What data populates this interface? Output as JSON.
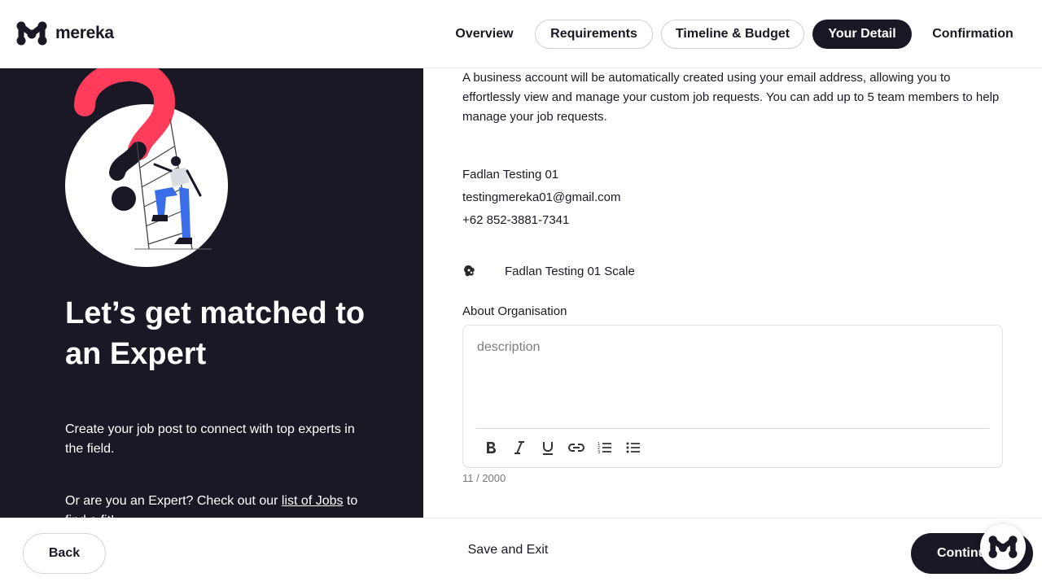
{
  "brand": {
    "name": "mereka"
  },
  "nav": {
    "steps": [
      {
        "label": "Overview",
        "style": "plain"
      },
      {
        "label": "Requirements",
        "style": "outlined"
      },
      {
        "label": "Timeline & Budget",
        "style": "outlined"
      },
      {
        "label": "Your Detail",
        "style": "active"
      },
      {
        "label": "Confirmation",
        "style": "plain"
      }
    ]
  },
  "hero": {
    "title": "Let’s get matched to an Expert",
    "description": "Create your job post to connect with top experts in the field.",
    "expert_prefix": "Or are you an Expert? Check out our ",
    "expert_link": "list of Jobs",
    "expert_suffix": " to find a fit!"
  },
  "detail": {
    "notice": "A business account will be automatically created using your email address, allowing you to effortlessly view and manage your custom job requests. You can add up to 5 team members to help manage your job requests.",
    "name": "Fadlan Testing 01",
    "email": "testingmereka01@gmail.com",
    "phone": "+62 852-3881-7341",
    "organisation": "Fadlan Testing 01 Scale",
    "about_label": "About Organisation",
    "about_value": "description",
    "char_counter": "11 / 2000"
  },
  "footer": {
    "back": "Back",
    "save_exit": "Save and Exit",
    "continue": "Continue"
  },
  "colors": {
    "dark": "#1b1826",
    "accent_red": "#ff3c5a",
    "person_blue": "#3a6ee8"
  }
}
